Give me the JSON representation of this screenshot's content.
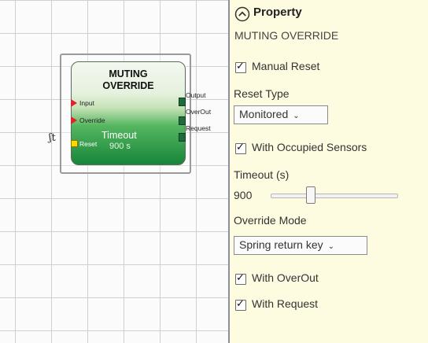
{
  "block": {
    "title_line1": "MUTING",
    "title_line2": "OVERRIDE",
    "inputs": [
      "Input",
      "Override",
      "Reset"
    ],
    "outputs": [
      "Output",
      "OverOut",
      "Request"
    ],
    "timeout_label": "Timeout",
    "timeout_value": "900 s",
    "reset_glyph": "ʃt"
  },
  "panel": {
    "title": "Property",
    "subtitle": "MUTING OVERRIDE",
    "manual_reset": "Manual Reset",
    "reset_type_label": "Reset Type",
    "reset_type_value": "Monitored",
    "with_occupied_sensors": "With Occupied Sensors",
    "timeout_label": "Timeout (s)",
    "timeout_value": "900",
    "timeout_slider_fraction": 0.3,
    "override_mode_label": "Override Mode",
    "override_mode_value": "Spring return key",
    "with_overout": "With OverOut",
    "with_request": "With Request"
  },
  "icons": [
    "collapse-chevron-up-icon",
    "checkbox-checked-icon",
    "dropdown-chevron-down-icon",
    "reset-pulse-icon",
    "input-arrow-icon",
    "output-port-icon"
  ],
  "colors": {
    "panel_bg": "#fefce0",
    "block_green": "#16863a",
    "input_arrow": "#e0202a",
    "reset_port": "#ffd800"
  }
}
